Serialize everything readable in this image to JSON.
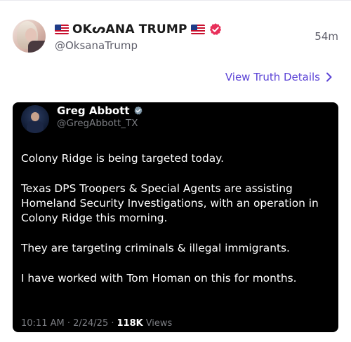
{
  "post": {
    "display_name": "OKᔕANA TRUMP",
    "handle": "@OksanaTrump",
    "time": "54m",
    "details_link": "View Truth Details"
  },
  "embed": {
    "name": "Greg Abbott",
    "handle": "@GregAbbott_TX",
    "paragraphs": [
      "Colony Ridge is being targeted today.",
      "Texas DPS Troopers & Special Agents are assisting Homeland Security Investigations, with an operation in Colony Ridge this morning.",
      "They are targeting criminals & illegal immigrants.",
      "I have worked with Tom Homan on this for months."
    ],
    "timestamp": "10:11 AM · 2/24/25 ·",
    "views_count": "118K",
    "views_label": "Views"
  },
  "colors": {
    "accent": "#5b43d6",
    "verified_badge": "#e8305a",
    "card_bg": "#000000",
    "muted_text": "#5f5f6b"
  },
  "icons": [
    "us-flag-icon",
    "verified-badge-icon",
    "chevron-right-icon",
    "gray-check-badge-icon"
  ]
}
